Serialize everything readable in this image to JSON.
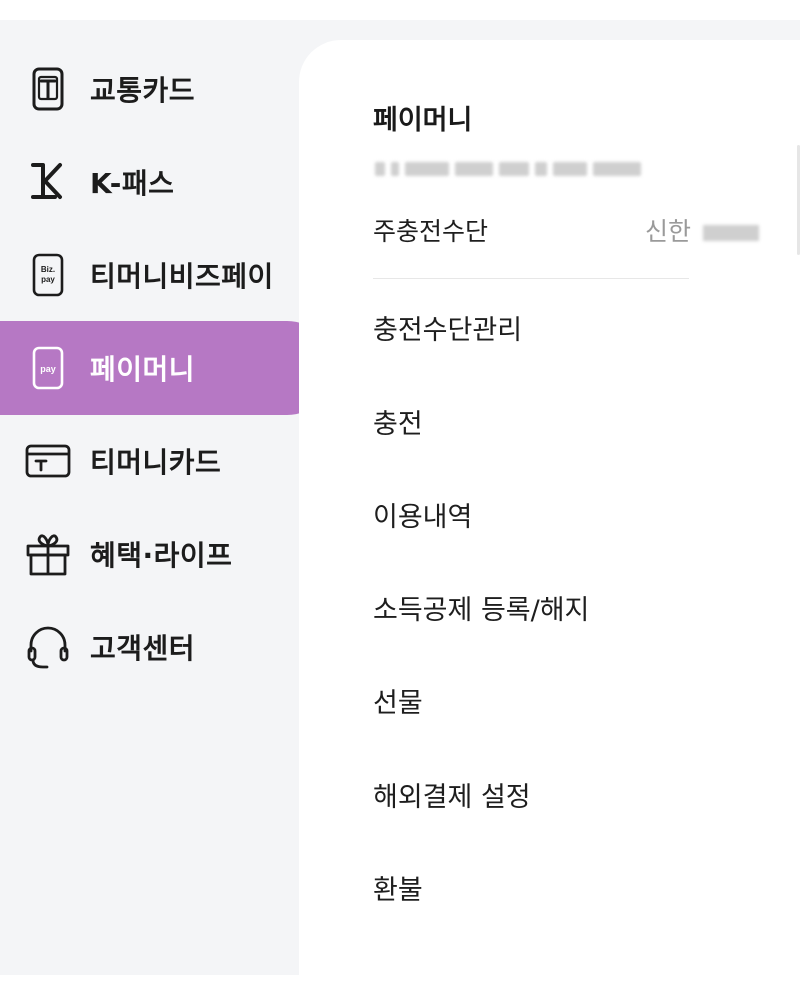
{
  "sidebar": {
    "items": [
      {
        "label": "교통카드",
        "icon": "transit-card-icon",
        "active": false
      },
      {
        "label": "K-패스",
        "icon": "k-pass-icon",
        "active": false
      },
      {
        "label": "티머니비즈페이",
        "icon": "biz-pay-phone-icon",
        "active": false
      },
      {
        "label": "페이머니",
        "icon": "pay-phone-icon",
        "active": true
      },
      {
        "label": "티머니카드",
        "icon": "tmoney-card-icon",
        "active": false
      },
      {
        "label": "혜택·라이프",
        "icon": "gift-icon",
        "active": false
      },
      {
        "label": "고객센터",
        "icon": "headset-icon",
        "active": false
      }
    ]
  },
  "panel": {
    "title": "페이머니",
    "account_masked": "",
    "charge_method": {
      "label": "주충전수단",
      "value": "신한"
    },
    "menu": [
      "충전수단관리",
      "충전",
      "이용내역",
      "소득공제 등록/해지",
      "선물",
      "해외결제 설정",
      "환불"
    ]
  },
  "colors": {
    "active_bg": "#b678c4",
    "sidebar_bg": "#f4f5f7",
    "panel_bg": "#ffffff",
    "text": "#1e1e1e",
    "muted": "#9a9a9a"
  }
}
